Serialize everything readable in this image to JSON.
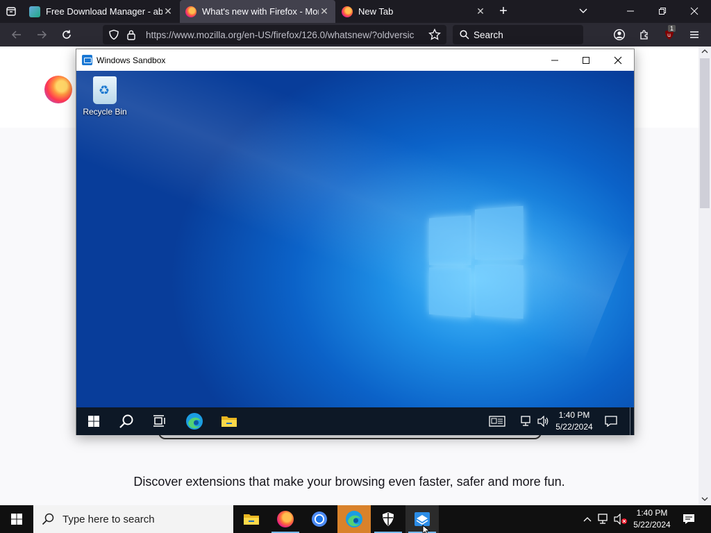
{
  "tabs": [
    {
      "title": "Free Download Manager - abso",
      "icon": "fdm-icon",
      "active": false
    },
    {
      "title": "What's new with Firefox - More",
      "icon": "firefox-icon",
      "active": true
    },
    {
      "title": "New Tab",
      "icon": "firefox-icon",
      "active": false
    }
  ],
  "navbar": {
    "url": "https://www.mozilla.org/en-US/firefox/126.0/whatsnew/?oldversic",
    "search_placeholder": "Search",
    "extension_badge": "1"
  },
  "page": {
    "discover_text": "Discover extensions that make your browsing even faster, safer and more fun."
  },
  "sandbox": {
    "title": "Windows Sandbox",
    "desktop_icon_label": "Recycle Bin",
    "clock_time": "1:40 PM",
    "clock_date": "5/22/2024"
  },
  "taskbar": {
    "search_placeholder": "Type here to search",
    "clock_time": "1:40 PM",
    "clock_date": "5/22/2024"
  },
  "colors": {
    "firefox_tabbar": "#1c1b22",
    "firefox_navbar": "#2b2a33",
    "taskbar": "#101010",
    "sandbox_taskbar": "#0d1826",
    "active_app": "#d9822b"
  }
}
